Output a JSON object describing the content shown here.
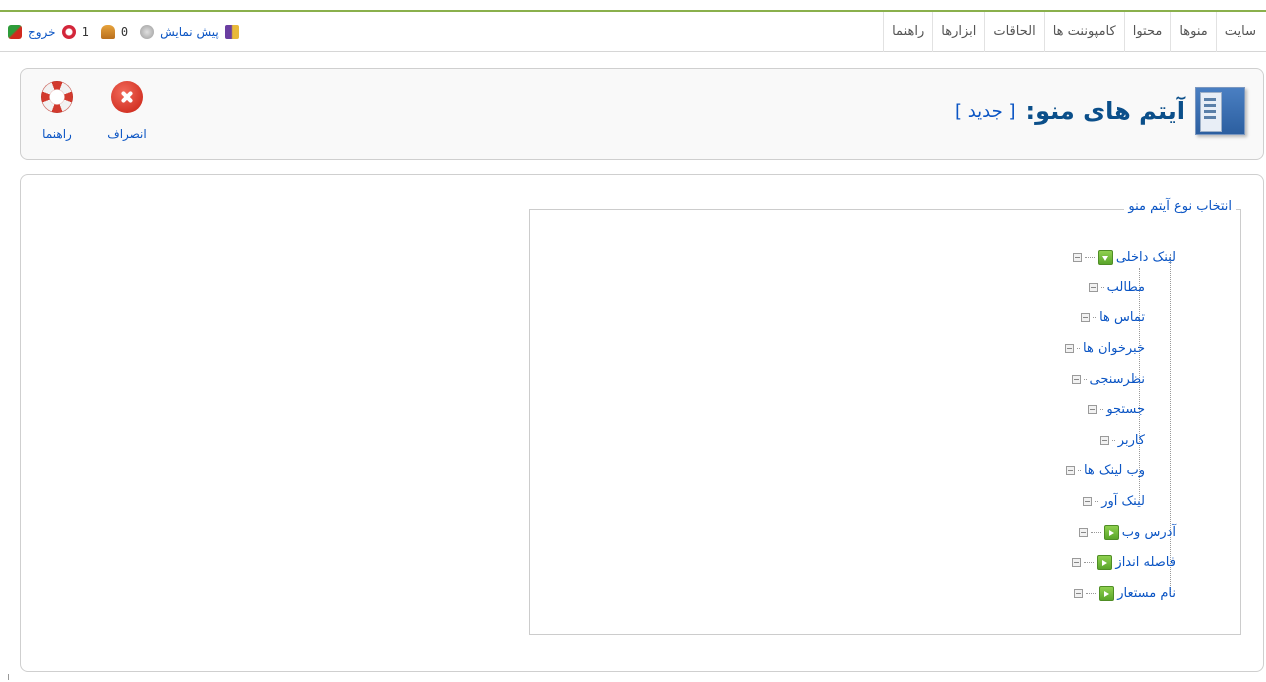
{
  "topbar": {
    "menu": [
      "سایت",
      "منوها",
      "محتوا",
      "کامپوننت ها",
      "الحاقات",
      "ابزارها",
      "راهنما"
    ],
    "status": {
      "logout_label": "خروج",
      "messages_count": "1",
      "users_count": "0",
      "preview_label": "پیش نمایش"
    }
  },
  "header": {
    "title": "آیتم های منو:",
    "subtitle": "[ جدید ]",
    "toolbar": {
      "cancel_label": "انصراف",
      "help_label": "راهنما"
    }
  },
  "main": {
    "legend": "انتخاب نوع آیتم منو",
    "tree": {
      "root": {
        "label": "لینک داخلی",
        "expanded": true
      },
      "children": [
        "مطالب",
        "تماس ها",
        "خبرخوان ها",
        "نظرسنجی",
        "جستجو",
        "کاربر",
        "وب لینک ها",
        "لینک آور"
      ],
      "siblings": [
        "آدرس وب",
        "فاصله انداز",
        "نام مستعار"
      ]
    }
  },
  "colors": {
    "accent": "#8ab04c",
    "link": "#0b55c4",
    "title": "#0b4f8a",
    "expander": "#6bb535",
    "cancel_icon": "#d32a1c"
  },
  "icons": {
    "title": "menu-item-icon",
    "cancel": "cancel-icon",
    "help": "help-lifebuoy-icon",
    "expand": "expand-arrow-icon"
  }
}
